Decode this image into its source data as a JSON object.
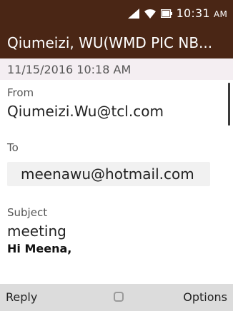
{
  "status_bar": {
    "time": "10:31",
    "ampm": "AM",
    "icons": [
      "signal-icon",
      "wifi-icon",
      "battery-icon"
    ]
  },
  "header": {
    "title": "Qiumeizi, WU(WMD PIC NB..."
  },
  "message": {
    "date": "11/15/2016 10:18 AM",
    "from_label": "From",
    "from_value": "Qiumeizi.Wu@tcl.com",
    "to_label": "To",
    "to_value": "meenawu@hotmail.com",
    "subject_label": "Subject",
    "subject_value": "meeting",
    "body": "Hi Meena,"
  },
  "softkeys": {
    "left": "Reply",
    "center_icon": "select-icon",
    "right": "Options"
  },
  "colors": {
    "header_bg": "#4a2615",
    "date_strip_bg": "#f4eef2",
    "softkey_bg": "#dcdcdc",
    "chip_bg": "#f1f1f1"
  }
}
